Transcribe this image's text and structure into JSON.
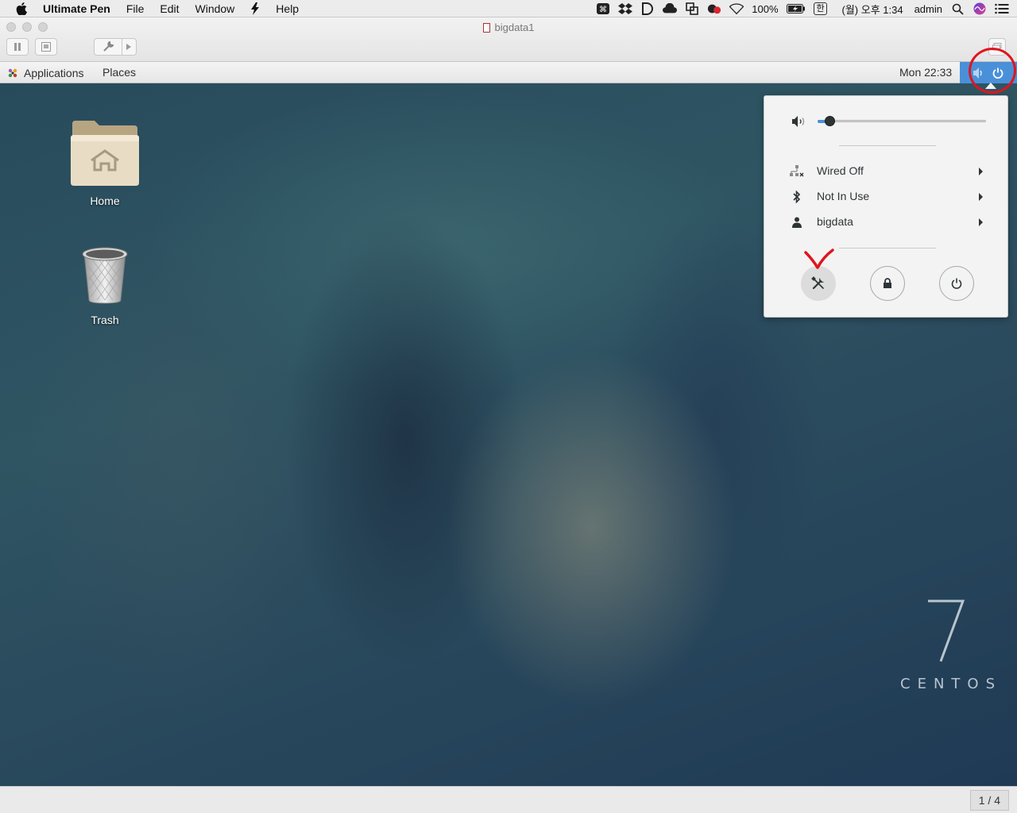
{
  "mac_menubar": {
    "app_name": "Ultimate Pen",
    "menus": [
      "File",
      "Edit",
      "Window",
      "Help"
    ],
    "battery": "100%",
    "input_source": "한",
    "clock": "(월) 오후 1:34",
    "user": "admin"
  },
  "vm_window": {
    "title": "bigdata1"
  },
  "gnome_panel": {
    "applications": "Applications",
    "places": "Places",
    "clock": "Mon 22:33"
  },
  "desktop": {
    "icons": [
      {
        "label": "Home",
        "icon": "home-folder-icon"
      },
      {
        "label": "Trash",
        "icon": "trash-icon"
      }
    ],
    "branding": {
      "number": "7",
      "word": "CENTOS"
    }
  },
  "system_menu": {
    "volume_level": 0.07,
    "items": [
      {
        "label": "Wired Off",
        "icon": "wired-network-off-icon"
      },
      {
        "label": "Not In Use",
        "icon": "bluetooth-icon"
      },
      {
        "label": "bigdata",
        "icon": "user-icon"
      }
    ],
    "buttons": [
      "settings",
      "lock",
      "power"
    ]
  },
  "statusbar": {
    "page": "1 / 4"
  },
  "colors": {
    "accent": "#4a90d9",
    "annotation": "#e0141e"
  }
}
